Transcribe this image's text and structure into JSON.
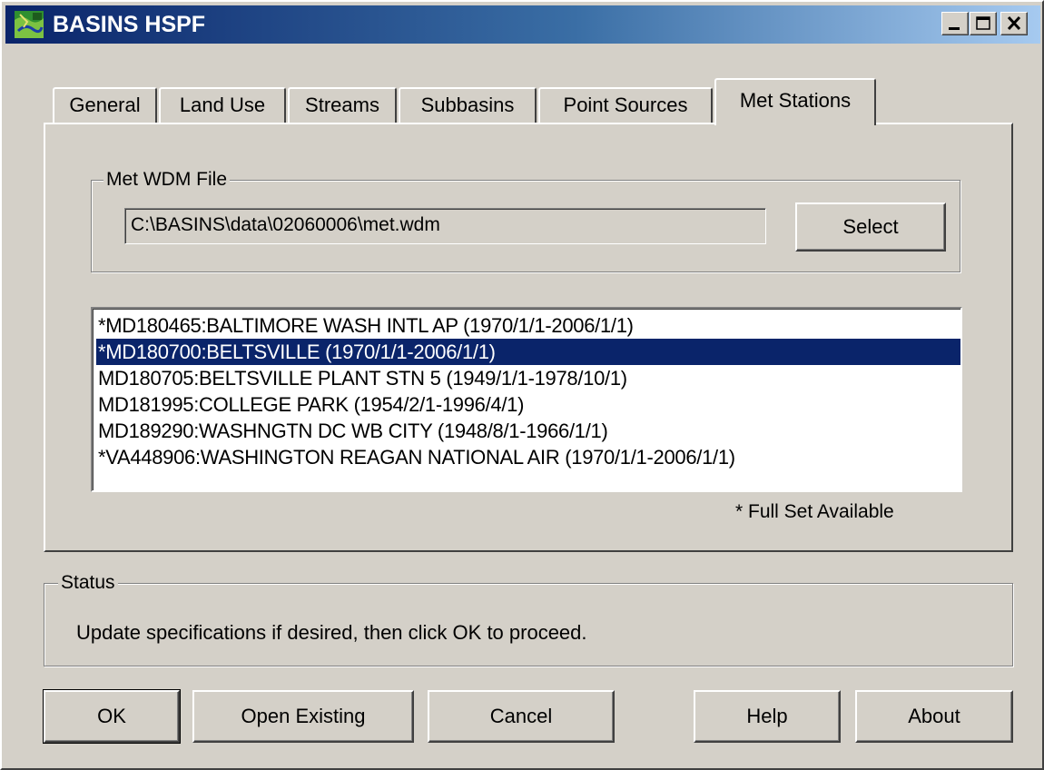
{
  "window": {
    "title": "BASINS HSPF",
    "buttons": {
      "minimize": "minimize-icon",
      "maximize": "maximize-icon",
      "close": "close-icon"
    }
  },
  "tabs": [
    {
      "label": "General"
    },
    {
      "label": "Land Use"
    },
    {
      "label": "Streams"
    },
    {
      "label": "Subbasins"
    },
    {
      "label": "Point Sources"
    },
    {
      "label": "Met Stations",
      "active": true
    }
  ],
  "met_wdm": {
    "group_label": "Met WDM File",
    "file_path": "C:\\BASINS\\data\\02060006\\met.wdm",
    "select_label": "Select"
  },
  "stations": {
    "items": [
      "*MD180465:BALTIMORE WASH INTL AP (1970/1/1-2006/1/1)",
      "*MD180700:BELTSVILLE (1970/1/1-2006/1/1)",
      "MD180705:BELTSVILLE PLANT STN 5 (1949/1/1-1978/10/1)",
      "MD181995:COLLEGE PARK (1954/2/1-1996/4/1)",
      "MD189290:WASHNGTN DC WB CITY (1948/8/1-1966/1/1)",
      "*VA448906:WASHINGTON REAGAN NATIONAL AIR (1970/1/1-2006/1/1)"
    ],
    "selected_index": 1,
    "footnote": "* Full Set Available"
  },
  "status": {
    "group_label": "Status",
    "message": "Update specifications if desired, then click OK to proceed."
  },
  "buttons": {
    "ok": "OK",
    "open_existing": "Open Existing",
    "cancel": "Cancel",
    "help": "Help",
    "about": "About"
  },
  "colors": {
    "titlebar_start": "#0a246a",
    "titlebar_end": "#a6caf0",
    "face": "#d4d0c8",
    "selection": "#0a246a"
  }
}
